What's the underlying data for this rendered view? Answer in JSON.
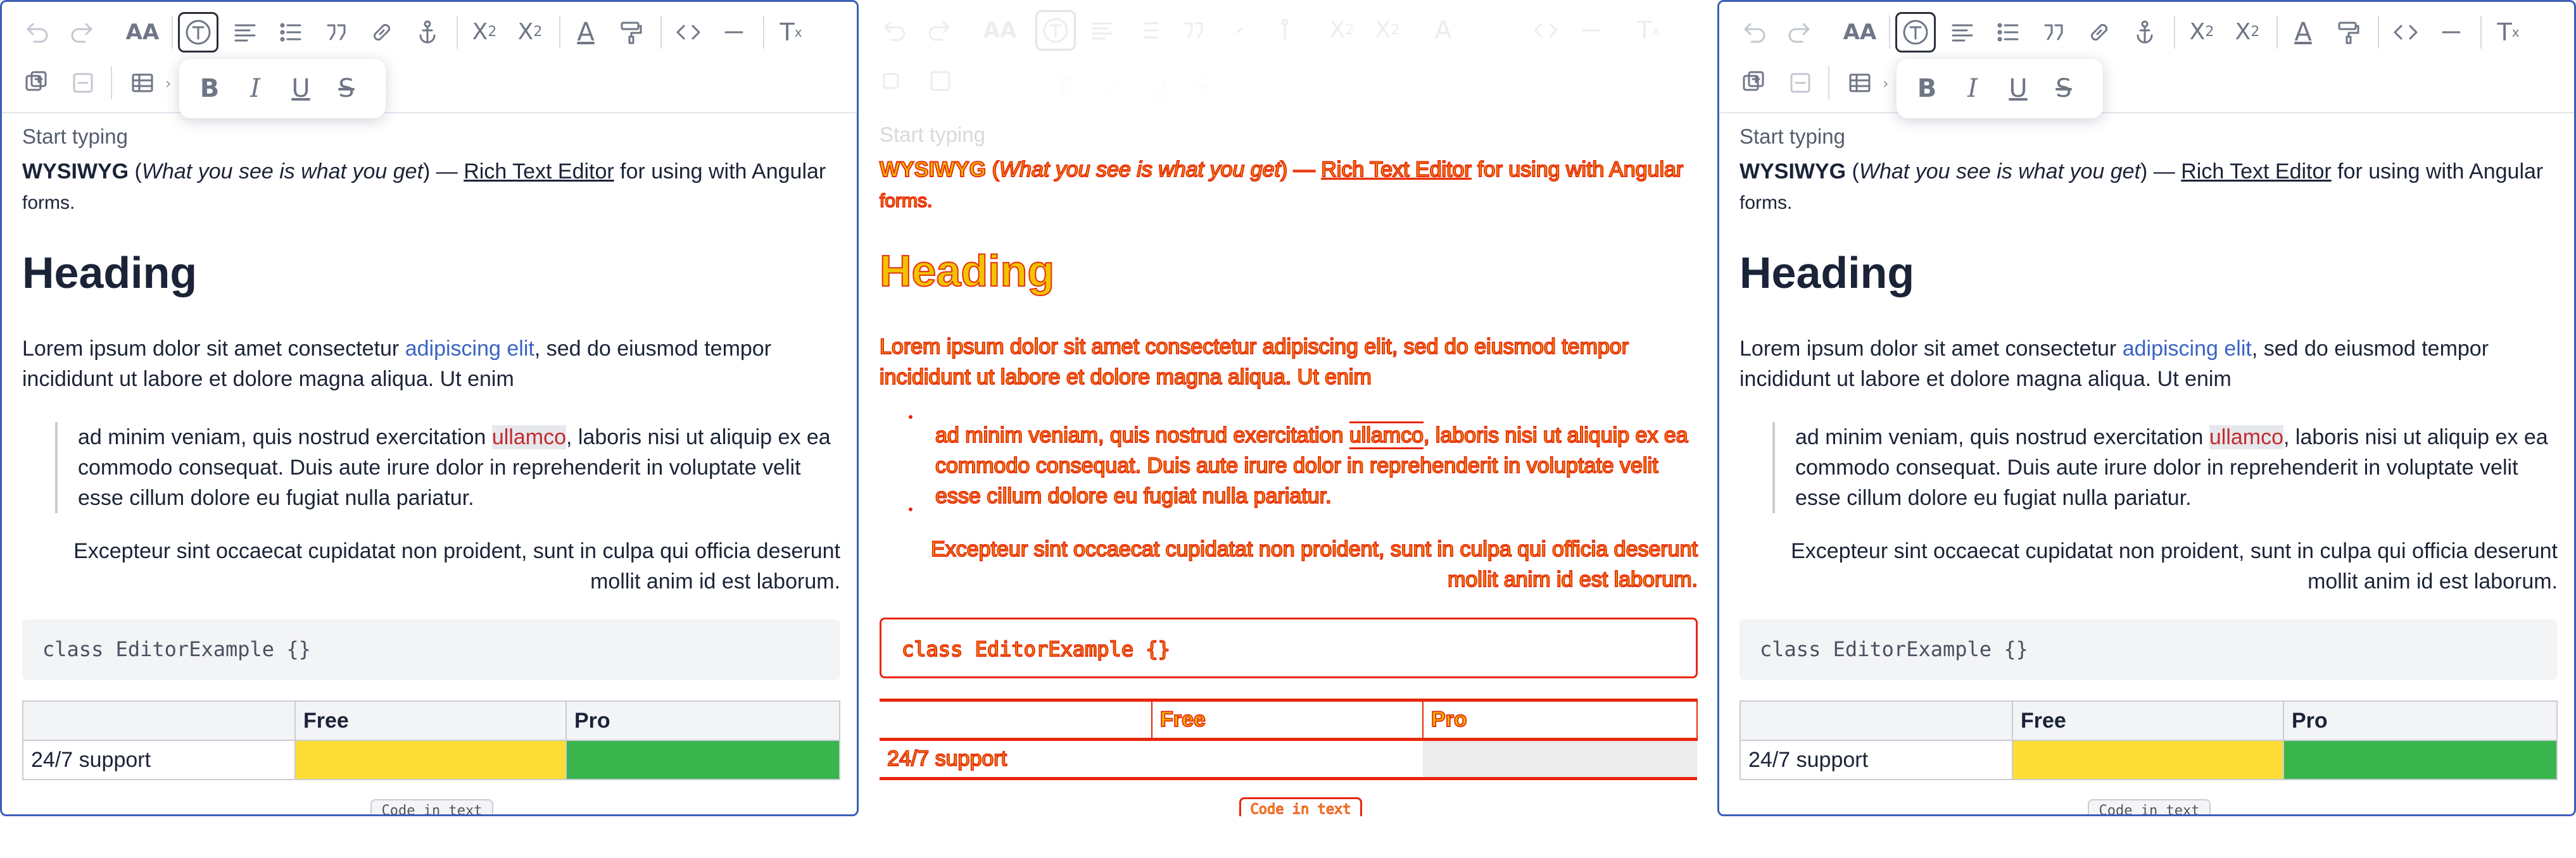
{
  "toolbar": {
    "undo_icon": "undo-icon",
    "redo_icon": "redo-icon",
    "font_size_label": "AA",
    "format_text_icon": "text-format-icon",
    "align_icon": "align-left-icon",
    "bullet_list_icon": "bullet-list-icon",
    "blockquote_icon": "quote-icon",
    "link_icon": "link-icon",
    "anchor_icon": "anchor-icon",
    "subscript_label": "X",
    "subscript_mark": "2",
    "superscript_label": "X",
    "superscript_mark": "2",
    "text_color_label": "A",
    "paint_icon": "paint-roller-icon",
    "code_icon": "code-icon",
    "hr_icon": "horizontal-rule-icon",
    "clear_format_label": "T",
    "clear_format_mark": "x",
    "insert_row_icon": "insert-icon",
    "delete_row_icon": "remove-icon",
    "table_icon": "table-icon",
    "chevron": "›"
  },
  "format_popup": {
    "bold": "B",
    "italic": "I",
    "underline": "U",
    "strike": "S"
  },
  "editor": {
    "placeholder": "Start typing",
    "intro_bold": "WYSIWYG",
    "intro_open": " (",
    "intro_italic": "What you see is what you get",
    "intro_close": ") — ",
    "intro_link": "Rich Text Editor",
    "intro_rest": " for using with Angular",
    "intro_forms": "forms.",
    "heading": "Heading",
    "para_start": "Lorem ipsum dolor sit amet consectetur ",
    "para_link": "adipiscing elit",
    "para_end": ", sed do eiusmod tempor incididunt ut labore et dolore magna aliqua. Ut enim",
    "quote_start": "ad minim veniam, quis nostrud exercitation ",
    "quote_mark": "ullamco",
    "quote_end": ", laboris nisi ut aliquip ex ea commodo consequat. Duis aute irure dolor in reprehenderit in voluptate velit esse cillum dolore eu fugiat nulla pariatur.",
    "right_aligned": "Excepteur sint occaecat cupidatat non proident, sunt in culpa qui officia deserunt mollit anim id est laborum.",
    "code": "class EditorExample {}",
    "table": {
      "headers": [
        "",
        "Free",
        "Pro"
      ],
      "row_label": "24/7 support"
    },
    "code_button": "Code in text"
  },
  "colors": {
    "accent_border": "#3d5fb8",
    "link": "#3a64c4",
    "highlight_text": "#c42b2b",
    "cell_yellow": "#fddc35",
    "cell_green": "#3ab54d",
    "diff_red": "#e8260c",
    "diff_yellow": "#f2c400"
  }
}
